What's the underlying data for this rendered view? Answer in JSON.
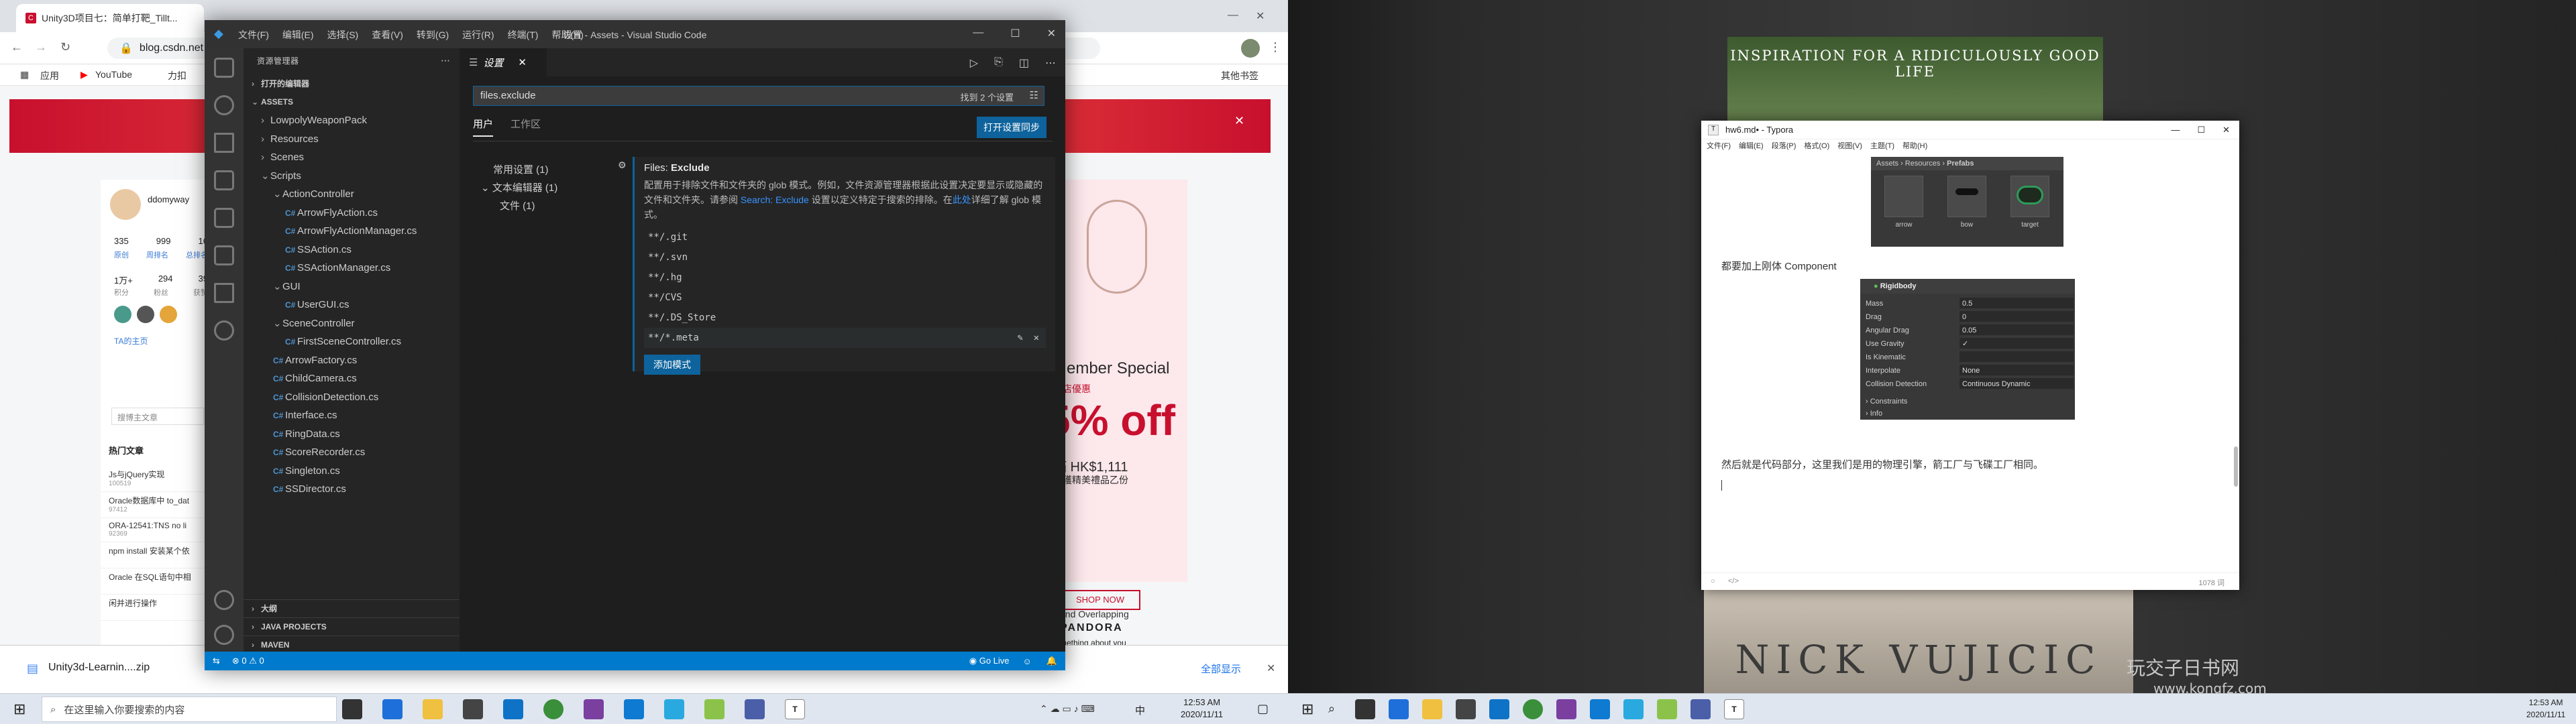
{
  "left": {
    "browser": {
      "tabs": [
        "Unity3D项目七：简单打靶_Tillt...",
        "设置 - Assets - Visual Studio Code"
      ],
      "url": "blog.csdn.net",
      "bookmarks": [
        "应用",
        "YouTube",
        "力扣",
        "其他书签"
      ],
      "profile": {
        "name": "ddomyway",
        "stats": [
          "335",
          "999",
          "16"
        ],
        "stat_labels": [
          "原创",
          "周排名",
          "总排名"
        ],
        "stats2": [
          "1万+",
          "294",
          "39"
        ],
        "stat_labels2": [
          "积分",
          "粉丝",
          "获赞"
        ],
        "link": "TA的主页"
      },
      "search_placeholder": "搜博主文章",
      "hot_title": "热门文章",
      "hot_items": [
        {
          "title": "Js与jQuery实现",
          "views": "100519"
        },
        {
          "title": "Oracle数据库中 to_dat",
          "views": "97412"
        },
        {
          "title": "ORA-12541:TNS no li",
          "views": "92369"
        },
        {
          "title": "npm install 安装某个依",
          "views": ""
        },
        {
          "title": "Oracle 在SQL语句中相",
          "views": ""
        },
        {
          "title": "闲并进行操作",
          "views": ""
        }
      ],
      "ad": {
        "line1": "Member Special",
        "line2": "全店優惠",
        "big": "5% off",
        "price": "滿 HK$1,111",
        "gift": "可獲精美禮品乙份",
        "cta": "SHOP NOW",
        "brand": "PANDORA",
        "tag": "mething about you",
        "below": "and Overlapping"
      },
      "download": {
        "file": "Unity3d-Learnin....zip",
        "show_all": "全部显示"
      }
    },
    "vscode": {
      "title": "设置 - Assets - Visual Studio Code",
      "menu": [
        "文件(F)",
        "编辑(E)",
        "选择(S)",
        "查看(V)",
        "转到(G)",
        "运行(R)",
        "终端(T)",
        "帮助(H)"
      ],
      "explorer_title": "资源管理器",
      "open_editors": "打开的编辑器",
      "root": "ASSETS",
      "tree": [
        {
          "label": "LowpolyWeaponPack",
          "type": "folder",
          "indent": 1,
          "twist": "›"
        },
        {
          "label": "Resources",
          "type": "folder",
          "indent": 1,
          "twist": "›"
        },
        {
          "label": "Scenes",
          "type": "folder",
          "indent": 1,
          "twist": "›"
        },
        {
          "label": "Scripts",
          "type": "folder",
          "indent": 1,
          "twist": "⌄"
        },
        {
          "label": "ActionController",
          "type": "folder",
          "indent": 2,
          "twist": "⌄"
        },
        {
          "label": "ArrowFlyAction.cs",
          "type": "cs",
          "indent": 3
        },
        {
          "label": "ArrowFlyActionManager.cs",
          "type": "cs",
          "indent": 3
        },
        {
          "label": "SSAction.cs",
          "type": "cs",
          "indent": 3
        },
        {
          "label": "SSActionManager.cs",
          "type": "cs",
          "indent": 3
        },
        {
          "label": "GUI",
          "type": "folder",
          "indent": 2,
          "twist": "⌄"
        },
        {
          "label": "UserGUI.cs",
          "type": "cs",
          "indent": 3
        },
        {
          "label": "SceneController",
          "type": "folder",
          "indent": 2,
          "twist": "⌄"
        },
        {
          "label": "FirstSceneController.cs",
          "type": "cs",
          "indent": 3
        },
        {
          "label": "ArrowFactory.cs",
          "type": "cs",
          "indent": 2
        },
        {
          "label": "ChildCamera.cs",
          "type": "cs",
          "indent": 2
        },
        {
          "label": "CollisionDetection.cs",
          "type": "cs",
          "indent": 2
        },
        {
          "label": "Interface.cs",
          "type": "cs",
          "indent": 2
        },
        {
          "label": "RingData.cs",
          "type": "cs",
          "indent": 2
        },
        {
          "label": "ScoreRecorder.cs",
          "type": "cs",
          "indent": 2
        },
        {
          "label": "Singleton.cs",
          "type": "cs",
          "indent": 2
        },
        {
          "label": "SSDirector.cs",
          "type": "cs",
          "indent": 2
        }
      ],
      "bottom_sections": [
        "大纲",
        "JAVA PROJECTS",
        "MAVEN"
      ],
      "tab_label": "设置",
      "search_value": "files.exclude",
      "search_count": "找到 2 个设置",
      "scopes": [
        "用户",
        "工作区"
      ],
      "sync_button": "打开设置同步",
      "toc": [
        "常用设置 (1)",
        "文本编辑器 (1)",
        "文件 (1)"
      ],
      "setting": {
        "title_prefix": "Files: ",
        "title": "Exclude",
        "desc1": "配置用于排除文件和文件夹的 glob 模式。例如，文件资源管理器根据此设置决定要显示或隐藏的文件和文件夹。请参阅 ",
        "link1": "Search: Exclude",
        "desc2": " 设置以定义特定于搜索的排除。在",
        "link2": "此处",
        "desc3": "详细了解 glob 模式。",
        "patterns": [
          "**/.git",
          "**/.svn",
          "**/.hg",
          "**/CVS",
          "**/.DS_Store",
          "**/*.meta"
        ],
        "add_button": "添加模式"
      },
      "status": {
        "errors": "0",
        "warnings": "0",
        "golive": "Go Live"
      }
    },
    "taskbar": {
      "search": "在这里输入你要搜索的内容",
      "time": "12:53 AM",
      "date": "2020/11/11",
      "ime": "中"
    }
  },
  "right": {
    "book_top": "INSPIRATION FOR A RIDICULOUSLY GOOD LIFE",
    "book_bottom": "NICK VUJICIC",
    "watermark": "玩交子日书网",
    "watermark_url": "www.kongfz.com",
    "typora": {
      "title": "hw6.md• - Typora",
      "menu": [
        "文件(F)",
        "编辑(E)",
        "段落(P)",
        "格式(O)",
        "视图(V)",
        "主题(T)",
        "帮助(H)"
      ],
      "unity_breadcrumb": [
        "Assets",
        "Resources",
        "Prefabs"
      ],
      "prefabs": [
        "arrow",
        "bow",
        "target"
      ],
      "text1": "都要加上刚体 Component",
      "rigidbody": {
        "header": "Rigidbody",
        "rows": [
          {
            "k": "Mass",
            "v": "0.5"
          },
          {
            "k": "Drag",
            "v": "0"
          },
          {
            "k": "Angular Drag",
            "v": "0.05"
          },
          {
            "k": "Use Gravity",
            "v": "✓"
          },
          {
            "k": "Is Kinematic",
            "v": ""
          },
          {
            "k": "Interpolate",
            "v": "None"
          },
          {
            "k": "Collision Detection",
            "v": "Continuous Dynamic"
          }
        ],
        "foldouts": [
          "Constraints",
          "Info"
        ]
      },
      "text2": "然后就是代码部分，这里我们是用的物理引擎，箭工厂与飞碟工厂相同。",
      "word_count": "1078 词"
    },
    "taskbar": {
      "time": "12:53 AM",
      "date": "2020/11/11"
    }
  }
}
